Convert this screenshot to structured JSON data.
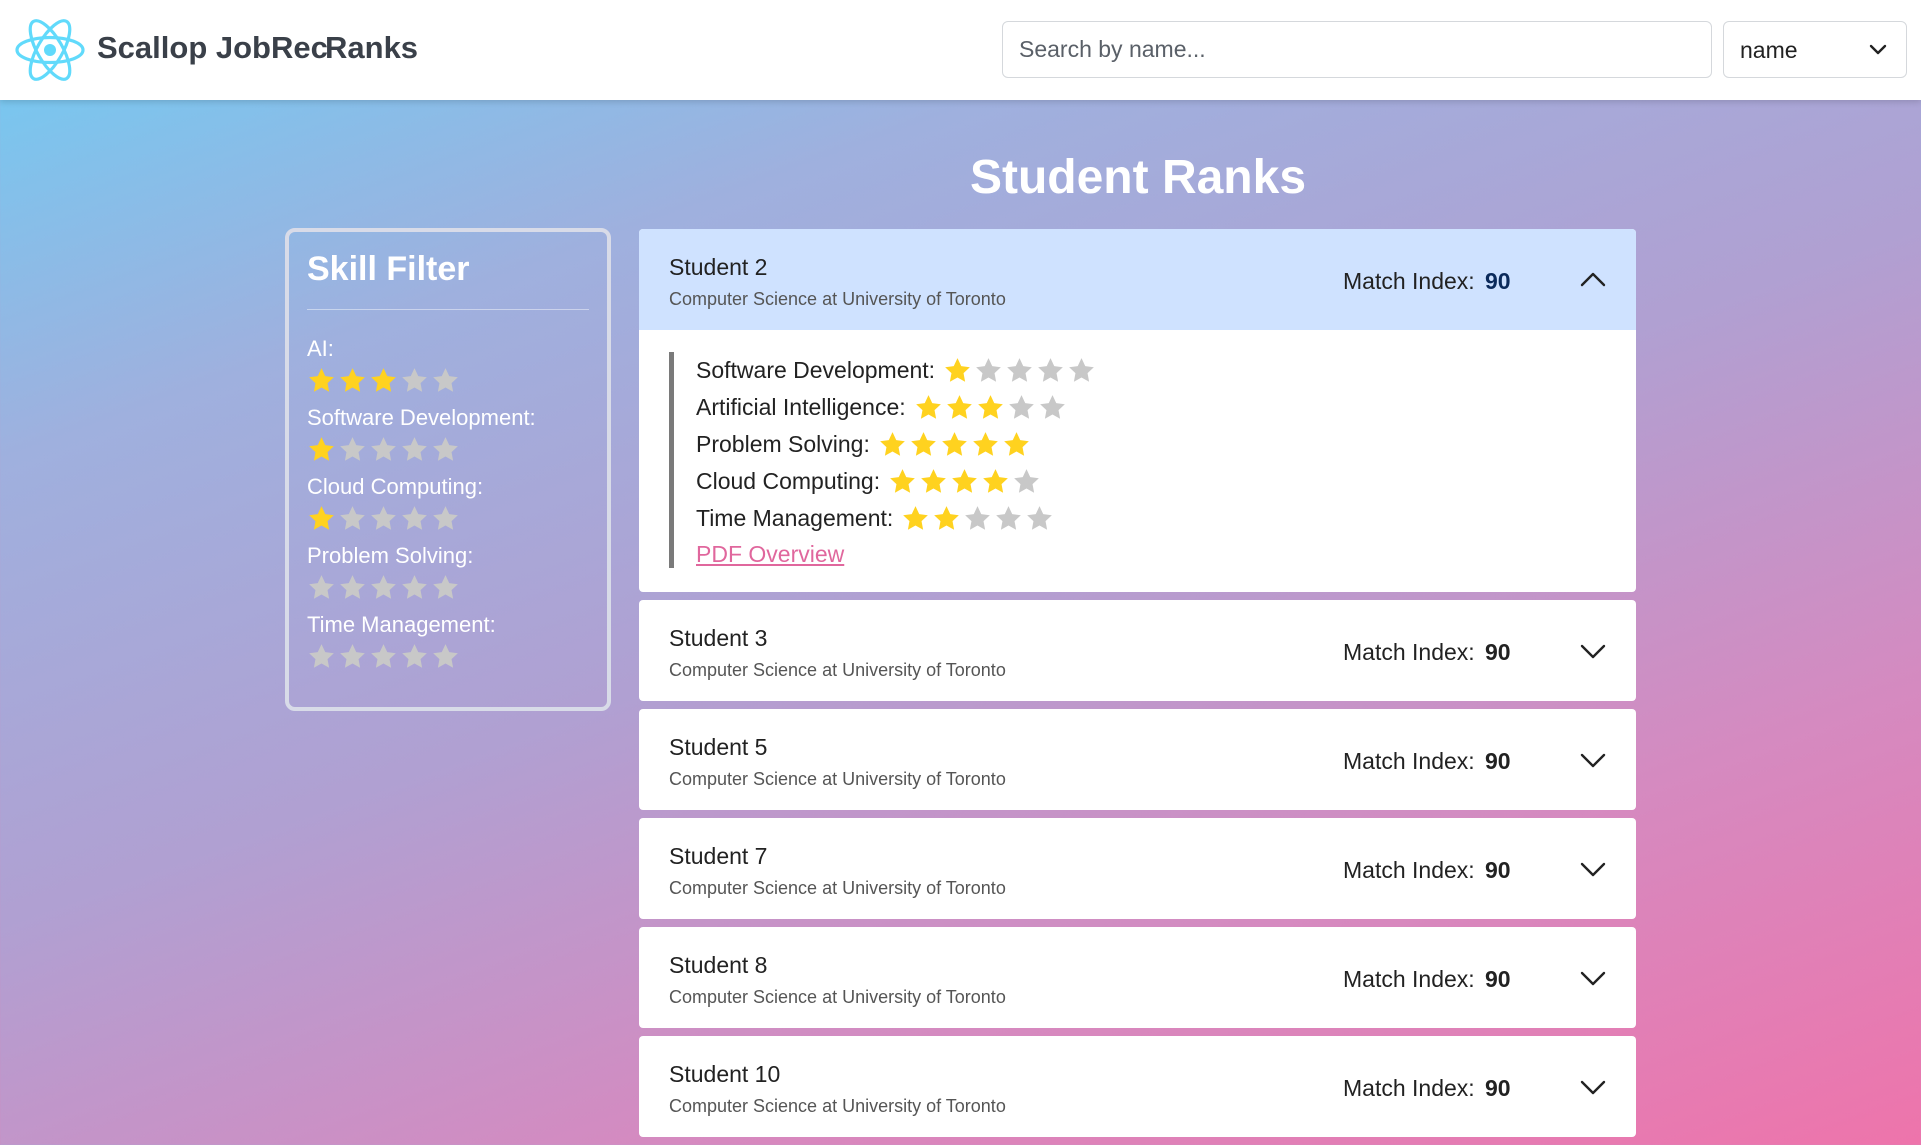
{
  "colors": {
    "star_filled": "#ffd21f",
    "star_empty": "#c8c8c8",
    "react_logo": "#61dafb",
    "expanded_header": "#cfe2ff",
    "link": "#e0679d"
  },
  "header": {
    "logo_icon": "react-atom-icon",
    "brand": "Scallop JobRec",
    "nav_link": "Ranks",
    "search": {
      "placeholder": "Search by name...",
      "value": ""
    },
    "sort": {
      "selected": "name",
      "icon": "chevron-down-icon"
    }
  },
  "page_title": "Student Ranks",
  "skill_filter": {
    "title": "Skill Filter",
    "max_rating": 5,
    "items": [
      {
        "label": "AI:",
        "rating": 3
      },
      {
        "label": "Software Development:",
        "rating": 1
      },
      {
        "label": "Cloud Computing:",
        "rating": 1
      },
      {
        "label": "Problem Solving:",
        "rating": 0
      },
      {
        "label": "Time Management:",
        "rating": 0
      }
    ]
  },
  "students": [
    {
      "name": "Student 2",
      "subtitle": "Computer Science at University of Toronto",
      "match_label": "Match Index:",
      "match_value": "90",
      "expanded": true,
      "skills": [
        {
          "label": "Software Development:",
          "rating": 1
        },
        {
          "label": "Artificial Intelligence:",
          "rating": 3
        },
        {
          "label": "Problem Solving:",
          "rating": 5
        },
        {
          "label": "Cloud Computing:",
          "rating": 4
        },
        {
          "label": "Time Management:",
          "rating": 2
        }
      ],
      "link_label": "PDF Overview"
    },
    {
      "name": "Student 3",
      "subtitle": "Computer Science at University of Toronto",
      "match_label": "Match Index:",
      "match_value": "90",
      "expanded": false
    },
    {
      "name": "Student 5",
      "subtitle": "Computer Science at University of Toronto",
      "match_label": "Match Index:",
      "match_value": "90",
      "expanded": false
    },
    {
      "name": "Student 7",
      "subtitle": "Computer Science at University of Toronto",
      "match_label": "Match Index:",
      "match_value": "90",
      "expanded": false
    },
    {
      "name": "Student 8",
      "subtitle": "Computer Science at University of Toronto",
      "match_label": "Match Index:",
      "match_value": "90",
      "expanded": false
    },
    {
      "name": "Student 10",
      "subtitle": "Computer Science at University of Toronto",
      "match_label": "Match Index:",
      "match_value": "90",
      "expanded": false
    }
  ]
}
